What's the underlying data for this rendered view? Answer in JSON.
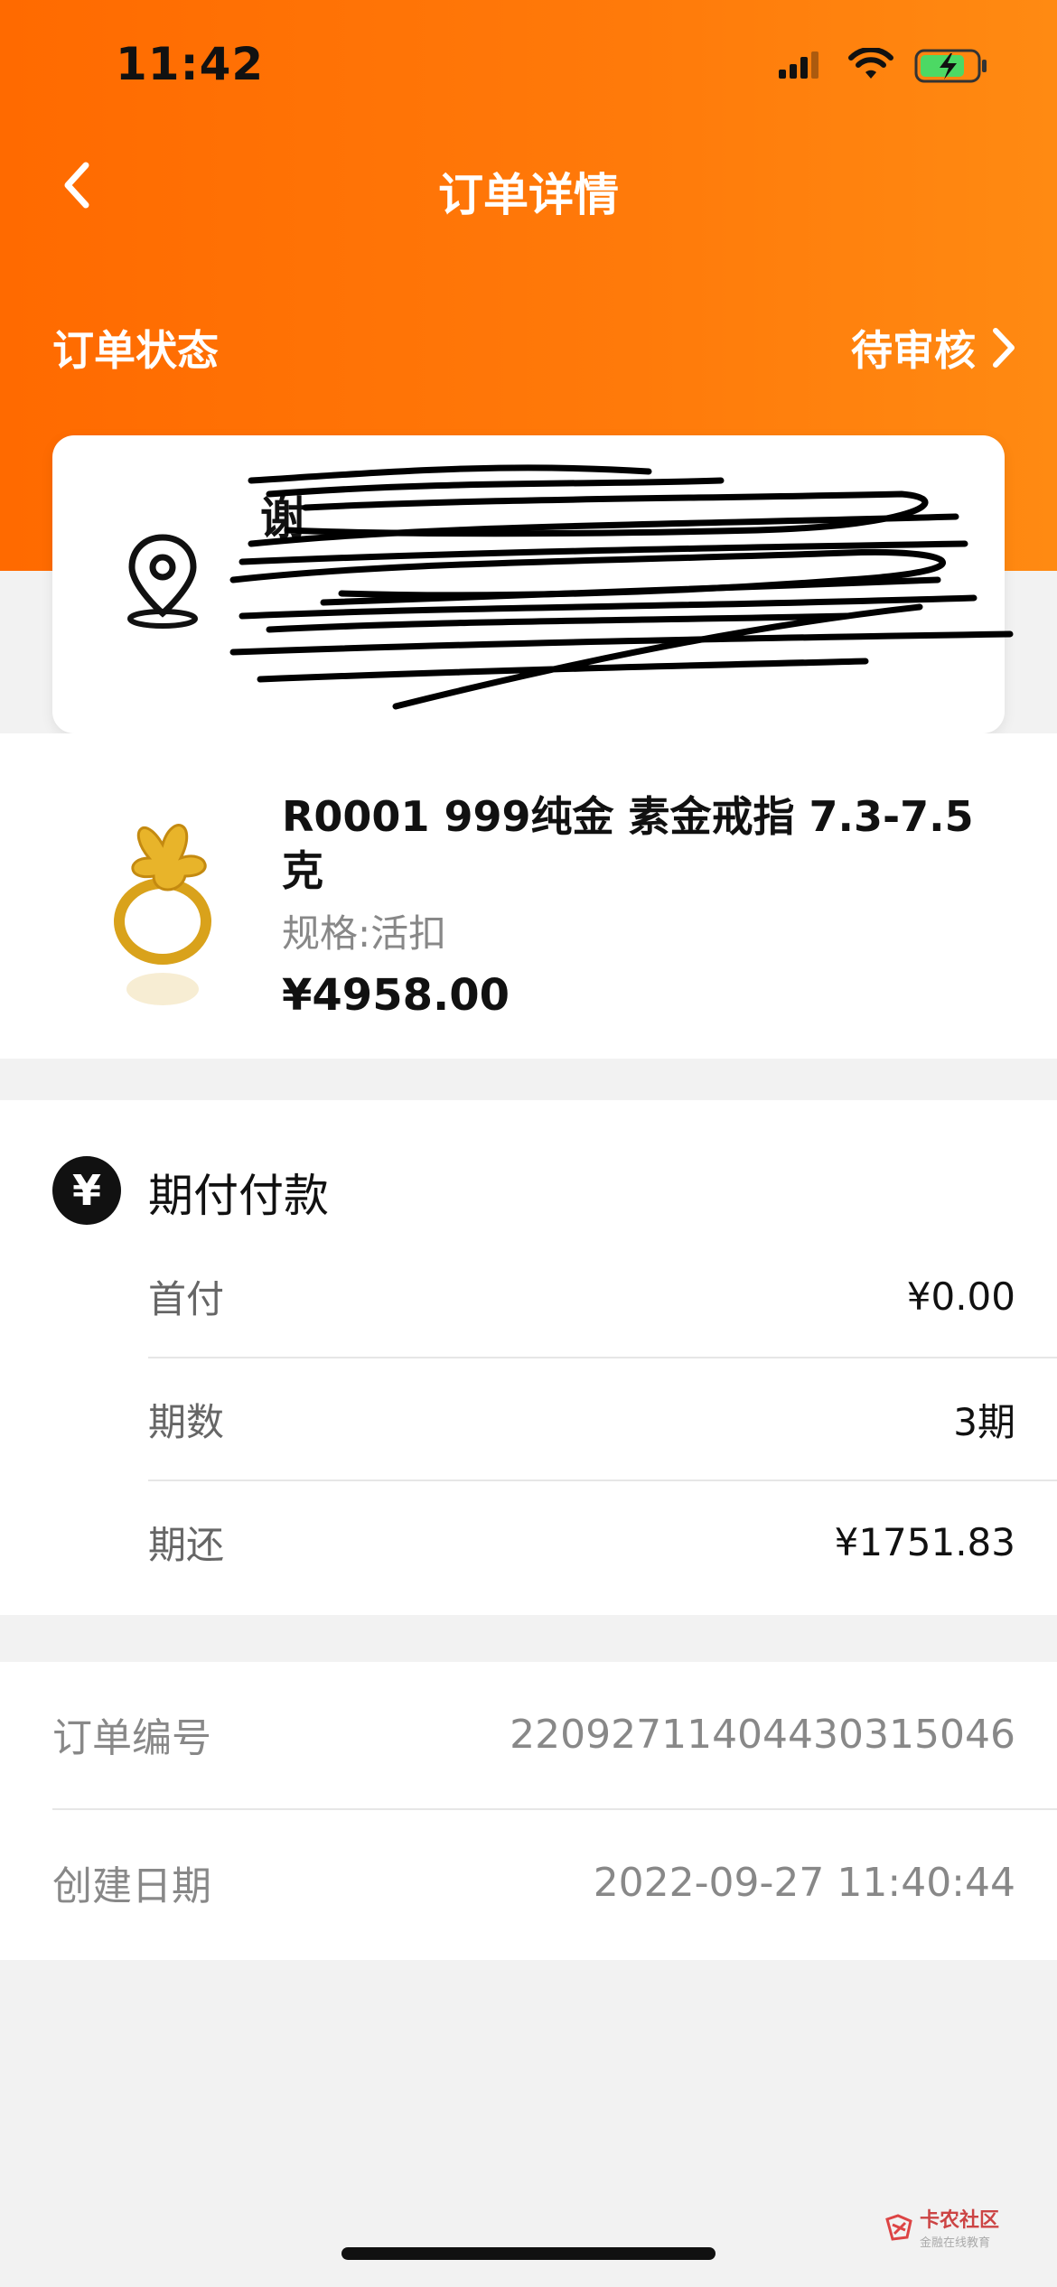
{
  "status_bar": {
    "time": "11:42"
  },
  "nav": {
    "title": "订单详情"
  },
  "order_status": {
    "label": "订单状态",
    "value": "待审核"
  },
  "address": {
    "name_visible": "谢"
  },
  "product": {
    "name": "R0001 999纯金 素金戒指 7.3-7.5克",
    "spec": "规格:活扣",
    "price": "¥4958.00"
  },
  "payment": {
    "icon": "¥",
    "title": "期付付款",
    "rows": [
      {
        "label": "首付",
        "value": "¥0.00"
      },
      {
        "label": "期数",
        "value": "3期"
      },
      {
        "label": "期还",
        "value": "¥1751.83"
      }
    ]
  },
  "info": {
    "order_no_label": "订单编号",
    "order_no": "220927114044303150​46",
    "created_label": "创建日期",
    "created": "2022-09-27 11:40:44"
  },
  "watermark": {
    "text": "卡农社区",
    "sub": "金融在线教育"
  },
  "colors": {
    "accent": "#ff7a0a"
  }
}
